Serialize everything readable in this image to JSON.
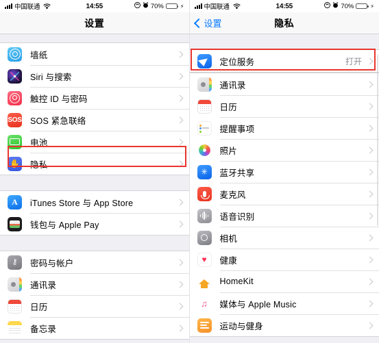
{
  "status_bar": {
    "carrier": "中国联通",
    "time": "14:55",
    "battery_percent": "70%",
    "icons": [
      "signal-bars-icon",
      "wifi-icon",
      "rotation-lock-icon",
      "alarm-icon",
      "battery-icon",
      "charging-bolt-icon"
    ]
  },
  "left_screen": {
    "nav": {
      "title": "设置"
    },
    "sections": [
      {
        "rows": [
          {
            "icon": "wallpaper-icon",
            "label": "墙纸",
            "value": ""
          },
          {
            "icon": "siri-icon",
            "label": "Siri 与搜索",
            "value": ""
          },
          {
            "icon": "touch-id-icon",
            "label": "触控 ID 与密码",
            "value": ""
          },
          {
            "icon": "sos-icon",
            "label": "SOS 紧急联络",
            "value": ""
          },
          {
            "icon": "battery-icon",
            "label": "电池",
            "value": ""
          },
          {
            "icon": "privacy-hand-icon",
            "label": "隐私",
            "value": ""
          }
        ]
      },
      {
        "rows": [
          {
            "icon": "app-store-icon",
            "label": "iTunes Store 与 App Store",
            "value": ""
          },
          {
            "icon": "wallet-icon",
            "label": "钱包与 Apple Pay",
            "value": ""
          }
        ]
      },
      {
        "rows": [
          {
            "icon": "passwords-key-icon",
            "label": "密码与帐户",
            "value": ""
          },
          {
            "icon": "contacts-icon",
            "label": "通讯录",
            "value": ""
          },
          {
            "icon": "calendar-icon",
            "label": "日历",
            "value": ""
          },
          {
            "icon": "notes-icon",
            "label": "备忘录",
            "value": ""
          }
        ]
      }
    ]
  },
  "right_screen": {
    "nav": {
      "back_label": "设置",
      "title": "隐私"
    },
    "sections": [
      {
        "rows": [
          {
            "icon": "location-arrow-icon",
            "label": "定位服务",
            "value": "打开"
          }
        ]
      },
      {
        "rows": [
          {
            "icon": "contacts-icon",
            "label": "通讯录",
            "value": ""
          },
          {
            "icon": "calendar-icon",
            "label": "日历",
            "value": ""
          },
          {
            "icon": "reminders-icon",
            "label": "提醒事项",
            "value": ""
          },
          {
            "icon": "photos-icon",
            "label": "照片",
            "value": ""
          },
          {
            "icon": "bluetooth-icon",
            "label": "蓝牙共享",
            "value": ""
          },
          {
            "icon": "microphone-icon",
            "label": "麦克风",
            "value": ""
          },
          {
            "icon": "speech-recognition-icon",
            "label": "语音识别",
            "value": ""
          },
          {
            "icon": "camera-icon",
            "label": "相机",
            "value": ""
          },
          {
            "icon": "health-icon",
            "label": "健康",
            "value": ""
          },
          {
            "icon": "homekit-icon",
            "label": "HomeKit",
            "value": ""
          },
          {
            "icon": "apple-music-icon",
            "label": "媒体与 Apple Music",
            "value": ""
          },
          {
            "icon": "fitness-icon",
            "label": "运动与健身",
            "value": ""
          }
        ]
      }
    ]
  },
  "annotations": {
    "highlight_color": "#e8352e",
    "boxes": [
      "privacy-row-highlight",
      "location-services-row-highlight"
    ]
  }
}
